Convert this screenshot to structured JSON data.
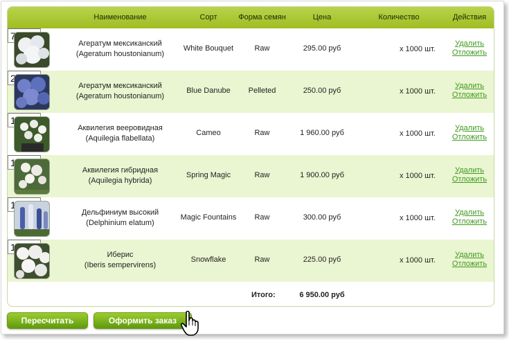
{
  "table": {
    "headers": {
      "name": "Наименование",
      "sort": "Сорт",
      "seed_form": "Форма семян",
      "price": "Цена",
      "quantity": "Количество",
      "actions": "Действия"
    },
    "rows": [
      {
        "name1": "Агератум мексиканский",
        "name2": "(Ageratum houstonianum)",
        "sort": "White Bouquet",
        "form": "Raw",
        "price": "295.00 руб",
        "qty": "7",
        "unit": "x 1000 шт.",
        "remove": "Удалить",
        "defer": "Отложить",
        "image": "white-ageratum-photo"
      },
      {
        "name1": "Агератум мексиканский",
        "name2": "(Ageratum houstonianum)",
        "sort": "Blue Danube",
        "form": "Pelleted",
        "price": "250.00 руб",
        "qty": "2",
        "unit": "x 1000 шт.",
        "remove": "Удалить",
        "defer": "Отложить",
        "image": "blue-ageratum-photo"
      },
      {
        "name1": "Аквилегия вееровидная",
        "name2": "(Aquilegia flabellata)",
        "sort": "Cameo",
        "form": "Raw",
        "price": "1 960.00 руб",
        "qty": "1",
        "unit": "x 1000 шт.",
        "remove": "Удалить",
        "defer": "Отложить",
        "image": "aquilegia-cameo-photo"
      },
      {
        "name1": "Аквилегия гибридная",
        "name2": "(Aquilegia hybrida)",
        "sort": "Spring Magic",
        "form": "Raw",
        "price": "1 900.00 руб",
        "qty": "1",
        "unit": "x 1000 шт.",
        "remove": "Удалить",
        "defer": "Отложить",
        "image": "aquilegia-hybrid-photo"
      },
      {
        "name1": "Дельфиниум высокий",
        "name2": "(Delphinium elatum)",
        "sort": "Magic Fountains",
        "form": "Raw",
        "price": "300.00 руб",
        "qty": "1",
        "unit": "x 1000 шт.",
        "remove": "Удалить",
        "defer": "Отложить",
        "image": "delphinium-photo"
      },
      {
        "name1": "Иберис",
        "name2": "(Iberis sempervirens)",
        "sort": "Snowflake",
        "form": "Raw",
        "price": "225.00 руб",
        "qty": "1",
        "unit": "x 1000 шт.",
        "remove": "Удалить",
        "defer": "Отложить",
        "image": "iberis-photo"
      }
    ],
    "total_label": "Итого:",
    "total_value": "6 950.00 руб"
  },
  "buttons": {
    "recalc": "Пересчитать",
    "checkout": "Оформить заказ"
  },
  "colors": {
    "header_green": "#9fbd22",
    "row_alt": "#eaf5d1",
    "link_green": "#3d9a1d",
    "button_green": "#7cb41f"
  },
  "cursor_icon": "hand-pointer-icon"
}
